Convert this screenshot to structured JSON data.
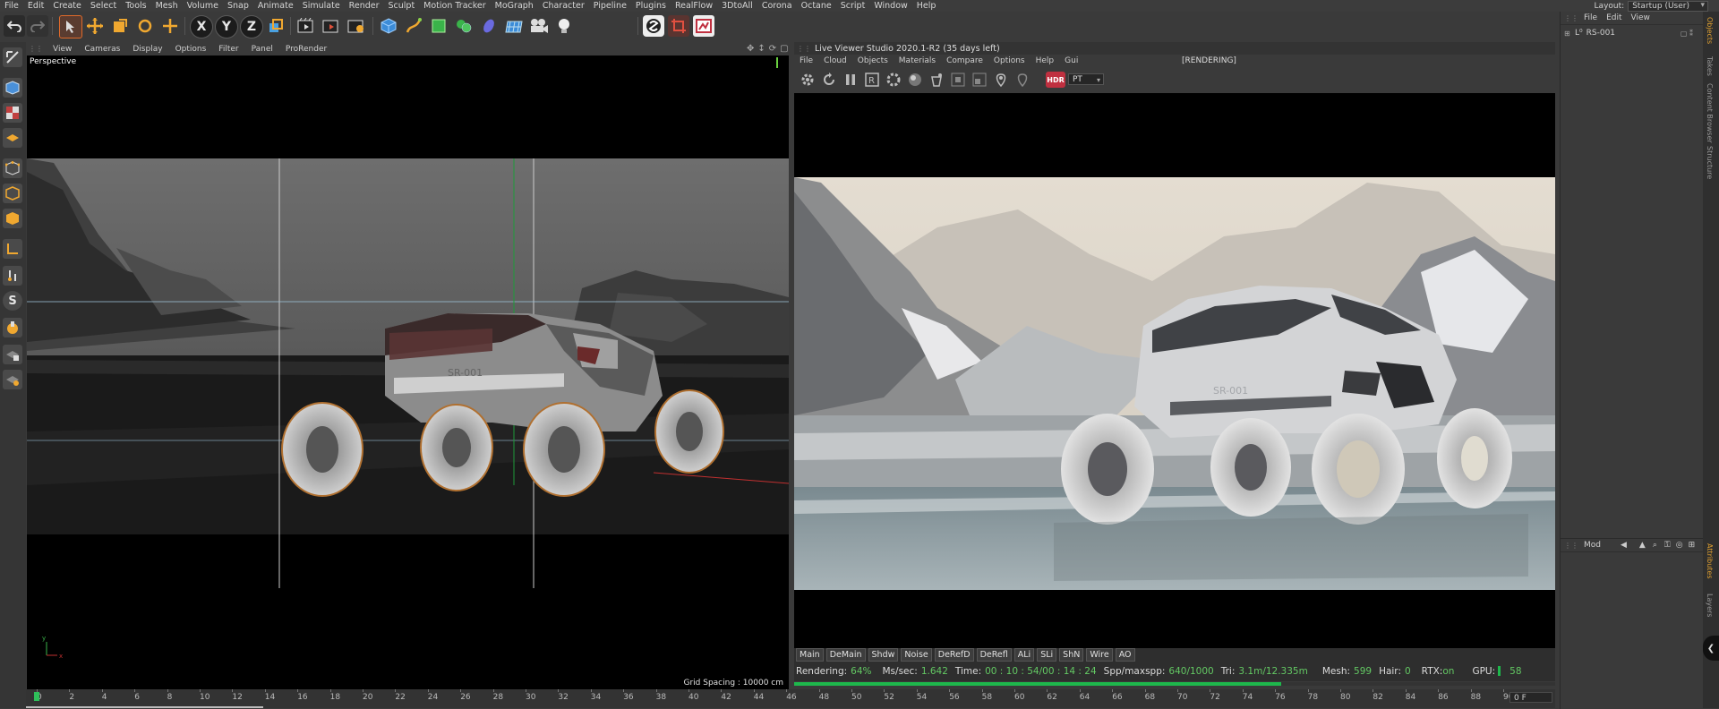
{
  "menu": [
    "File",
    "Edit",
    "Create",
    "Select",
    "Tools",
    "Mesh",
    "Volume",
    "Snap",
    "Animate",
    "Simulate",
    "Render",
    "Sculpt",
    "Motion Tracker",
    "MoGraph",
    "Character",
    "Pipeline",
    "Plugins",
    "RealFlow",
    "3DtoAll",
    "Corona",
    "Octane",
    "Script",
    "Window",
    "Help"
  ],
  "layout": {
    "label": "Layout:",
    "value": "Startup (User)"
  },
  "toolbar": {
    "axes": [
      "X",
      "Y",
      "Z"
    ]
  },
  "viewport": {
    "menu": [
      "View",
      "Cameras",
      "Display",
      "Options",
      "Filter",
      "Panel",
      "ProRender"
    ],
    "label": "Perspective",
    "grid_spacing": "Grid Spacing : 10000 cm",
    "vehicle_plate": "SR-001"
  },
  "live_viewer": {
    "title": "Live Viewer Studio 2020.1-R2 (35 days left)",
    "state": "[RENDERING]",
    "menu": [
      "File",
      "Cloud",
      "Objects",
      "Materials",
      "Compare",
      "Options",
      "Help",
      "Gui"
    ],
    "hdr": "HDR",
    "mode": "PT",
    "vehicle_plate": "SR-001",
    "passes": [
      "Main",
      "DeMain",
      "Shdw",
      "Noise",
      "DeRefD",
      "DeRefl",
      "ALi",
      "SLi",
      "ShN",
      "Wire",
      "AO"
    ],
    "status": {
      "rendering_label": "Rendering:",
      "rendering_value": "64%",
      "mssec_label": "Ms/sec:",
      "mssec_value": "1.642",
      "time_label": "Time:",
      "time_value": "00 : 10 : 54/00 : 14 : 24",
      "spp_label": "Spp/maxspp:",
      "spp_value": "640/1000",
      "tri_label": "Tri:",
      "tri_value": "3.1m/12.335m",
      "mesh_label": "Mesh:",
      "mesh_value": "599",
      "hair_label": "Hair:",
      "hair_value": "0",
      "rtx_label": "RTX:",
      "rtx_value": "on",
      "gpu_label": "GPU:",
      "gpu_value": "58"
    },
    "progress": 0.64
  },
  "object_manager": {
    "menu": [
      "File",
      "Edit",
      "View"
    ],
    "object": "RS-001"
  },
  "attribute_manager": {
    "mode": "Mod"
  },
  "right_tabs": [
    "Objects",
    "Takes",
    "Content Browser",
    "Structure",
    "Attributes",
    "Layers"
  ],
  "timeline": {
    "ticks": [
      "0",
      "2",
      "4",
      "6",
      "8",
      "10",
      "12",
      "14",
      "16",
      "18",
      "20",
      "22",
      "24",
      "26",
      "28",
      "30",
      "32",
      "34",
      "36",
      "38",
      "40",
      "42",
      "44",
      "46",
      "48",
      "50",
      "52",
      "54",
      "56",
      "58",
      "60",
      "62",
      "64",
      "66",
      "68",
      "70",
      "72",
      "74",
      "76",
      "78",
      "80",
      "82",
      "84",
      "86",
      "88",
      "90"
    ],
    "frame": "0 F"
  },
  "colors": {
    "accent_green": "#1eb84c",
    "hdr_red": "#c03040",
    "status_green": "#63c863"
  }
}
